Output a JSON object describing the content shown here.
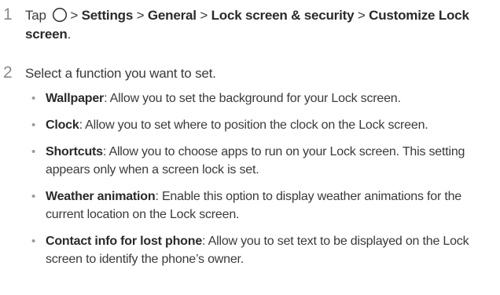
{
  "steps": [
    {
      "number": "1",
      "prefix": "Tap",
      "icon": "home-circle-icon",
      "path": [
        "Settings",
        "General",
        "Lock screen & security",
        "Customize Lock screen"
      ],
      "separator": ">",
      "end": "."
    },
    {
      "number": "2",
      "text": "Select a function you want to set.",
      "items": [
        {
          "term": "Wallpaper",
          "desc": ": Allow you to set the background for your Lock screen."
        },
        {
          "term": "Clock",
          "desc": ": Allow you to set where to position the clock on the Lock screen."
        },
        {
          "term": "Shortcuts",
          "desc": ": Allow you to choose apps to run on your Lock screen. This setting appears only when a screen lock is set."
        },
        {
          "term": "Weather animation",
          "desc": ": Enable this option to display weather animations for the current location on the Lock screen."
        },
        {
          "term": "Contact info for lost phone",
          "desc": ": Allow you to set text to be displayed on the Lock screen to identify the phone’s owner."
        }
      ]
    }
  ]
}
